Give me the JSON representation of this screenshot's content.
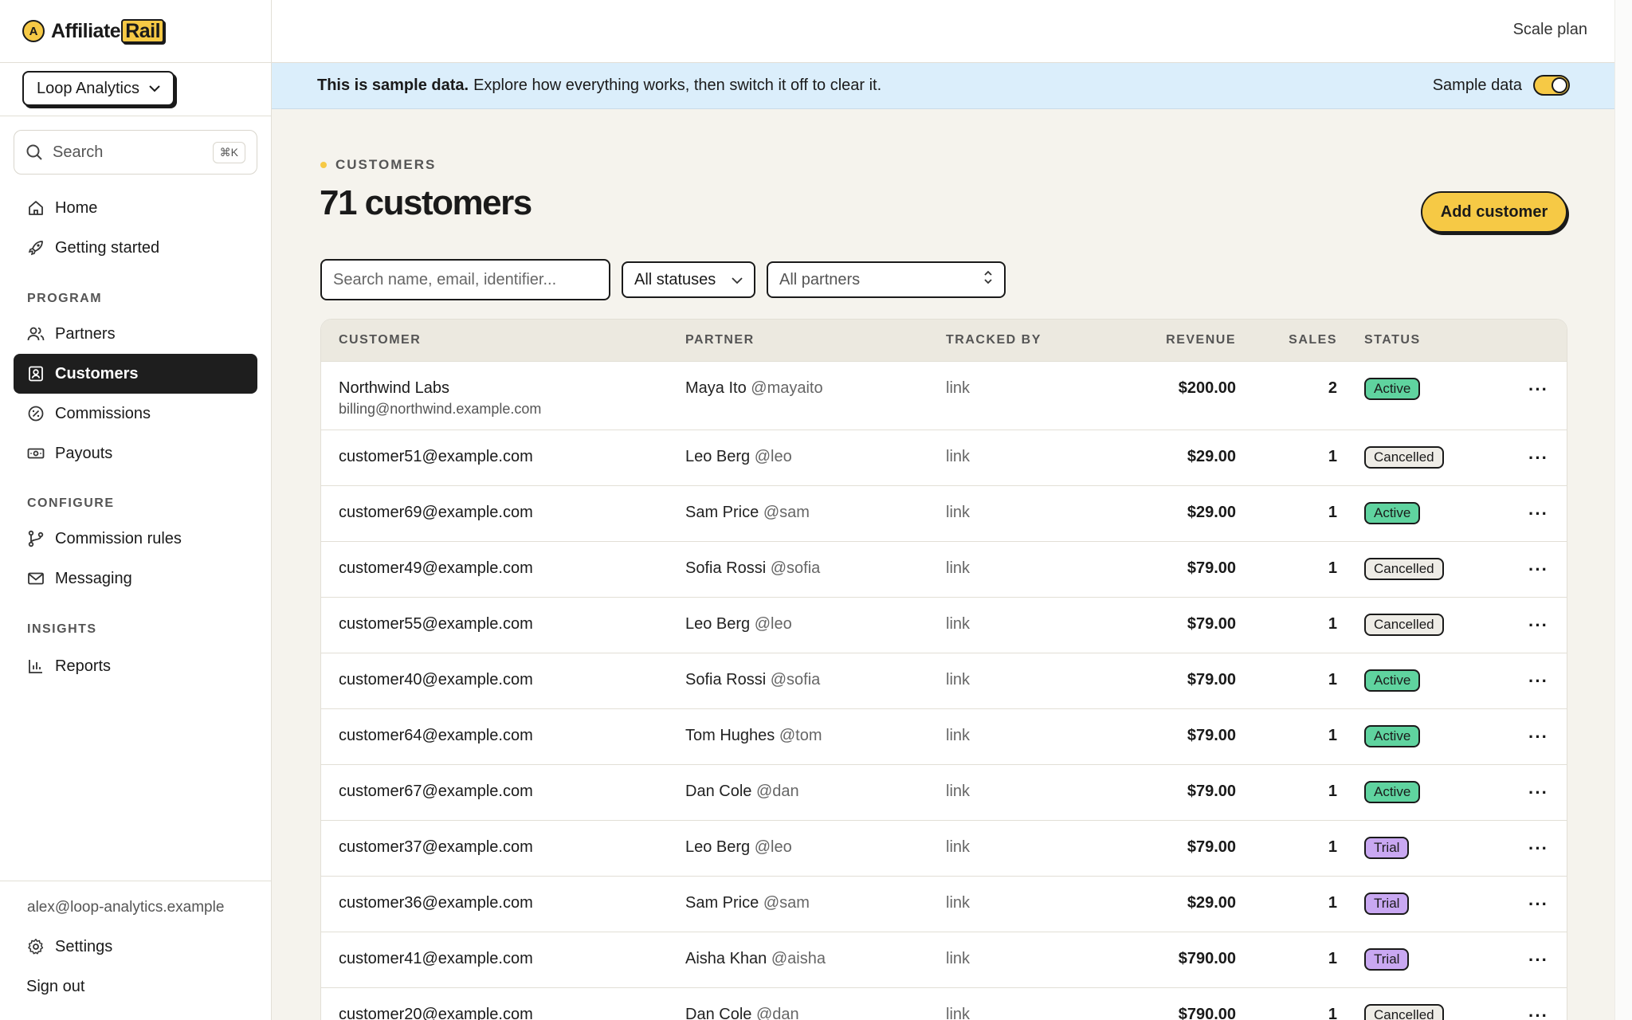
{
  "brand": {
    "name_prefix": "Affiliate",
    "name_suffix": "Rail",
    "mark": "A"
  },
  "org": {
    "name": "Loop Analytics"
  },
  "search": {
    "label": "Search",
    "shortcut": "⌘K"
  },
  "nav": {
    "home": "Home",
    "getting_started": "Getting started",
    "program_section": "PROGRAM",
    "partners": "Partners",
    "customers": "Customers",
    "commissions": "Commissions",
    "payouts": "Payouts",
    "configure_section": "CONFIGURE",
    "commission_rules": "Commission rules",
    "messaging": "Messaging",
    "insights_section": "INSIGHTS",
    "reports": "Reports"
  },
  "footer": {
    "user_email": "alex@loop-analytics.example",
    "settings": "Settings",
    "sign_out": "Sign out"
  },
  "topbar": {
    "plan": "Scale plan"
  },
  "banner": {
    "bold": "This is sample data.",
    "text": "Explore how everything works, then switch it off to clear it.",
    "toggle_label": "Sample data",
    "toggle_on": true
  },
  "page": {
    "eyebrow": "CUSTOMERS",
    "title": "71 customers",
    "add_button": "Add customer"
  },
  "filters": {
    "search_placeholder": "Search name, email, identifier...",
    "status": "All statuses",
    "partner": "All partners"
  },
  "table": {
    "headers": {
      "customer": "CUSTOMER",
      "partner": "PARTNER",
      "tracked_by": "TRACKED BY",
      "revenue": "REVENUE",
      "sales": "SALES",
      "status": "STATUS"
    },
    "rows": [
      {
        "customer": "Northwind Labs",
        "email": "billing@northwind.example.com",
        "partner": "Maya Ito",
        "handle": "@mayaito",
        "tracked": "link",
        "revenue": "$200.00",
        "sales": "2",
        "status": "Active"
      },
      {
        "customer": "customer51@example.com",
        "partner": "Leo Berg",
        "handle": "@leo",
        "tracked": "link",
        "revenue": "$29.00",
        "sales": "1",
        "status": "Cancelled"
      },
      {
        "customer": "customer69@example.com",
        "partner": "Sam Price",
        "handle": "@sam",
        "tracked": "link",
        "revenue": "$29.00",
        "sales": "1",
        "status": "Active"
      },
      {
        "customer": "customer49@example.com",
        "partner": "Sofia Rossi",
        "handle": "@sofia",
        "tracked": "link",
        "revenue": "$79.00",
        "sales": "1",
        "status": "Cancelled"
      },
      {
        "customer": "customer55@example.com",
        "partner": "Leo Berg",
        "handle": "@leo",
        "tracked": "link",
        "revenue": "$79.00",
        "sales": "1",
        "status": "Cancelled"
      },
      {
        "customer": "customer40@example.com",
        "partner": "Sofia Rossi",
        "handle": "@sofia",
        "tracked": "link",
        "revenue": "$79.00",
        "sales": "1",
        "status": "Active"
      },
      {
        "customer": "customer64@example.com",
        "partner": "Tom Hughes",
        "handle": "@tom",
        "tracked": "link",
        "revenue": "$79.00",
        "sales": "1",
        "status": "Active"
      },
      {
        "customer": "customer67@example.com",
        "partner": "Dan Cole",
        "handle": "@dan",
        "tracked": "link",
        "revenue": "$79.00",
        "sales": "1",
        "status": "Active"
      },
      {
        "customer": "customer37@example.com",
        "partner": "Leo Berg",
        "handle": "@leo",
        "tracked": "link",
        "revenue": "$79.00",
        "sales": "1",
        "status": "Trial"
      },
      {
        "customer": "customer36@example.com",
        "partner": "Sam Price",
        "handle": "@sam",
        "tracked": "link",
        "revenue": "$29.00",
        "sales": "1",
        "status": "Trial"
      },
      {
        "customer": "customer41@example.com",
        "partner": "Aisha Khan",
        "handle": "@aisha",
        "tracked": "link",
        "revenue": "$790.00",
        "sales": "1",
        "status": "Trial"
      },
      {
        "customer": "customer20@example.com",
        "partner": "Dan Cole",
        "handle": "@dan",
        "tracked": "link",
        "revenue": "$790.00",
        "sales": "1",
        "status": "Cancelled"
      }
    ],
    "row_menu_glyph": "···"
  },
  "colors": {
    "accent": "#f6c945",
    "active_badge": "#5fd39f",
    "trial_badge": "#c9a8f2",
    "cancelled_badge": "#eeece6",
    "banner_bg": "#dbeefb",
    "nav_active_bg": "#1e1e1e"
  },
  "icons": {
    "home": "home-icon",
    "getting_started": "rocket-icon",
    "partners": "users-icon",
    "customers": "id-card-icon",
    "commissions": "percent-badge-icon",
    "payouts": "banknote-icon",
    "commission_rules": "git-branch-icon",
    "messaging": "mail-icon",
    "reports": "bar-chart-icon",
    "settings": "gear-icon",
    "search": "search-icon"
  }
}
